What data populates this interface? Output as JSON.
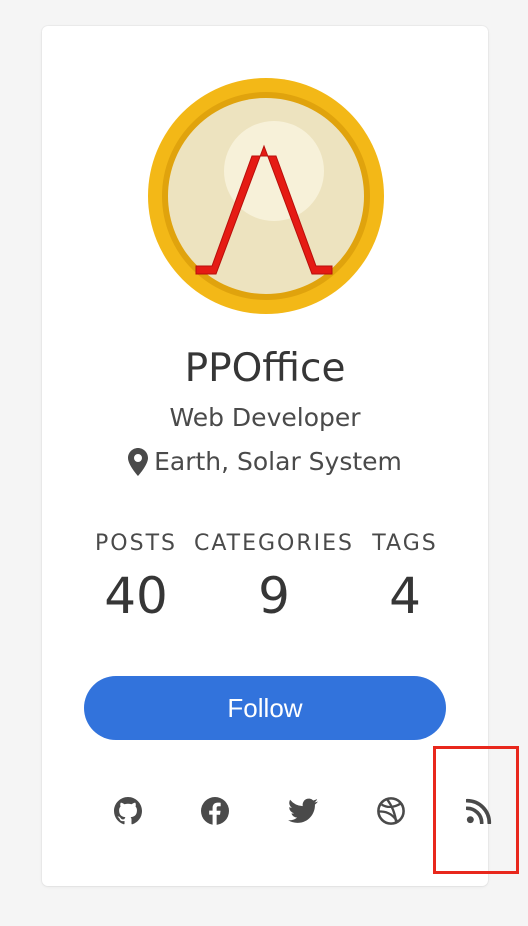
{
  "profile": {
    "name": "PPOffice",
    "role": "Web Developer",
    "location": "Earth, Solar System",
    "avatar_icon": "hexo-logo-icon"
  },
  "stats": [
    {
      "label": "POSTS",
      "value": "40"
    },
    {
      "label": "CATEGORIES",
      "value": "9"
    },
    {
      "label": "TAGS",
      "value": "4"
    }
  ],
  "follow_label": "Follow",
  "social_icons": [
    "github-icon",
    "facebook-icon",
    "twitter-icon",
    "dribbble-icon",
    "rss-icon"
  ],
  "colors": {
    "accent": "#3273dc",
    "highlight": "#e8271c",
    "icon": "#4a4a4a"
  }
}
